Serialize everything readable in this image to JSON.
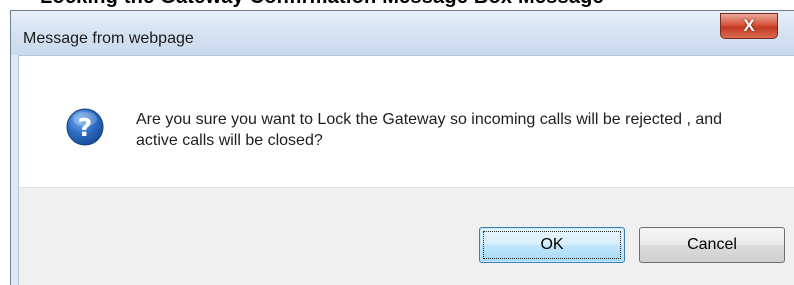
{
  "background_heading": "Locking the Gateway Confirmation Message Box Message",
  "dialog": {
    "title": "Message from webpage",
    "close_label": "X",
    "icon": "question-icon",
    "message": "Are you sure you want to Lock the Gateway so incoming calls will be rejected , and active calls will be closed?",
    "ok_label": "OK",
    "cancel_label": "Cancel"
  },
  "colors": {
    "close_button": "#c23a22",
    "icon_blue": "#1f5fb8",
    "ok_border": "#3c7fb1"
  }
}
